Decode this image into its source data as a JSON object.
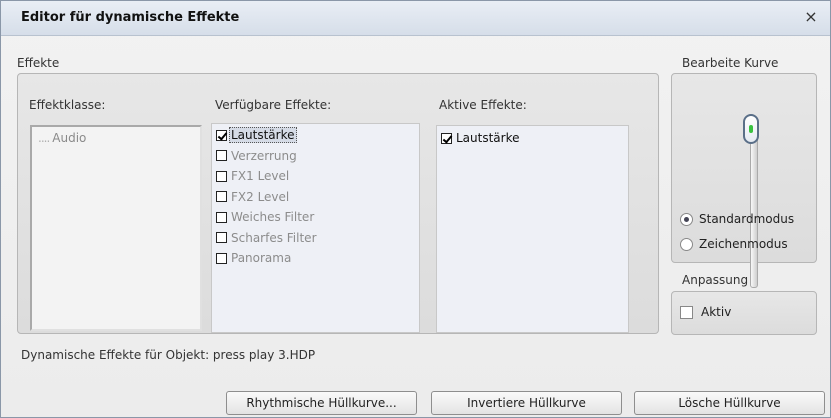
{
  "window": {
    "title": "Editor für dynamische Effekte",
    "close_glyph": "×"
  },
  "effects_group": {
    "label": "Effekte",
    "class_label": "Effektklasse:",
    "class_items": [
      {
        "dots": "....",
        "label": "Audio"
      }
    ],
    "available_label": "Verfügbare Effekte:",
    "available": [
      {
        "label": "Lautstärke",
        "checked": true,
        "selected": true
      },
      {
        "label": "Verzerrung",
        "checked": false,
        "selected": false
      },
      {
        "label": "FX1 Level",
        "checked": false,
        "selected": false
      },
      {
        "label": "FX2 Level",
        "checked": false,
        "selected": false
      },
      {
        "label": "Weiches Filter",
        "checked": false,
        "selected": false
      },
      {
        "label": "Scharfes Filter",
        "checked": false,
        "selected": false
      },
      {
        "label": "Panorama",
        "checked": false,
        "selected": false
      }
    ],
    "active_label": "Aktive Effekte:",
    "active": [
      {
        "label": "Lautstärke",
        "checked": true
      }
    ]
  },
  "curve_group": {
    "label": "Bearbeite Kurve",
    "slider_position": 0.1,
    "modes": [
      {
        "label": "Standardmodus",
        "selected": true
      },
      {
        "label": "Zeichenmodus",
        "selected": false
      }
    ]
  },
  "adjust_group": {
    "label": "Anpassung",
    "active_label": "Aktiv",
    "active_checked": false
  },
  "status": {
    "text": "Dynamische Effekte für Objekt: press play 3.HDP"
  },
  "buttons": {
    "rhythmic": "Rhythmische Hüllkurve...",
    "invert": "Invertiere Hüllkurve",
    "delete": "Lösche Hüllkurve"
  }
}
